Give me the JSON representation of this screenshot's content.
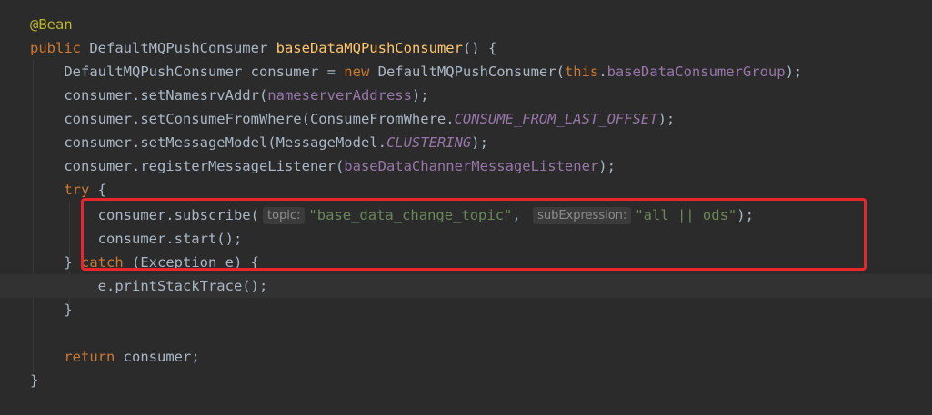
{
  "colors": {
    "background": "#2b2b2b",
    "current_line": "#323232",
    "keyword": "#cc7832",
    "annotation": "#bbb529",
    "method_decl": "#ffc66d",
    "field": "#9876aa",
    "string": "#6a8759",
    "default_text": "#a9b7c6",
    "inlay_hint": "#8c8c8c",
    "highlight_box": "#e8262b"
  },
  "code": {
    "lines": [
      [
        {
          "t": "@Bean",
          "k": "annotation"
        }
      ],
      [
        {
          "t": "public",
          "k": "keyword"
        },
        {
          "t": " DefaultMQPushConsumer ",
          "k": "plain"
        },
        {
          "t": "baseDataMQPushConsumer",
          "k": "method_decl"
        },
        {
          "t": "() {",
          "k": "plain"
        }
      ],
      [
        {
          "t": "    DefaultMQPushConsumer consumer = ",
          "k": "plain"
        },
        {
          "t": "new",
          "k": "keyword"
        },
        {
          "t": " DefaultMQPushConsumer(",
          "k": "plain"
        },
        {
          "t": "this",
          "k": "keyword"
        },
        {
          "t": ".",
          "k": "plain"
        },
        {
          "t": "baseDataConsumerGroup",
          "k": "field"
        },
        {
          "t": ");",
          "k": "plain"
        }
      ],
      [
        {
          "t": "    consumer.setNamesrvAddr(",
          "k": "plain"
        },
        {
          "t": "nameserverAddress",
          "k": "field"
        },
        {
          "t": ");",
          "k": "plain"
        }
      ],
      [
        {
          "t": "    consumer.setConsumeFromWhere(ConsumeFromWhere.",
          "k": "plain"
        },
        {
          "t": "CONSUME_FROM_LAST_OFFSET",
          "k": "static_field"
        },
        {
          "t": ");",
          "k": "plain"
        }
      ],
      [
        {
          "t": "    consumer.setMessageModel(MessageModel.",
          "k": "plain"
        },
        {
          "t": "CLUSTERING",
          "k": "static_field"
        },
        {
          "t": ");",
          "k": "plain"
        }
      ],
      [
        {
          "t": "    consumer.registerMessageListener(",
          "k": "plain"
        },
        {
          "t": "baseDataChannerMessageListener",
          "k": "field"
        },
        {
          "t": ");",
          "k": "plain"
        }
      ],
      [
        {
          "t": "    ",
          "k": "plain"
        },
        {
          "t": "try",
          "k": "keyword"
        },
        {
          "t": " {",
          "k": "plain"
        }
      ],
      [
        {
          "t": "        consumer.subscribe(",
          "k": "plain"
        },
        {
          "t": "topic:",
          "k": "hint"
        },
        {
          "t": "\"base_data_change_topic\"",
          "k": "string"
        },
        {
          "t": ", ",
          "k": "plain"
        },
        {
          "t": "subExpression:",
          "k": "hint"
        },
        {
          "t": "\"all || ods\"",
          "k": "string"
        },
        {
          "t": ");",
          "k": "plain"
        }
      ],
      [
        {
          "t": "        consumer.start();",
          "k": "plain"
        }
      ],
      [
        {
          "t": "    } ",
          "k": "plain"
        },
        {
          "t": "catch",
          "k": "keyword"
        },
        {
          "t": " (Exception e) {",
          "k": "plain"
        }
      ],
      [
        {
          "t": "        e.printStackTrace();",
          "k": "plain"
        }
      ],
      [
        {
          "t": "    }",
          "k": "plain"
        }
      ],
      [],
      [
        {
          "t": "    ",
          "k": "plain"
        },
        {
          "t": "return",
          "k": "keyword"
        },
        {
          "t": " consumer;",
          "k": "plain"
        }
      ],
      [
        {
          "t": "}",
          "k": "plain"
        }
      ]
    ]
  }
}
